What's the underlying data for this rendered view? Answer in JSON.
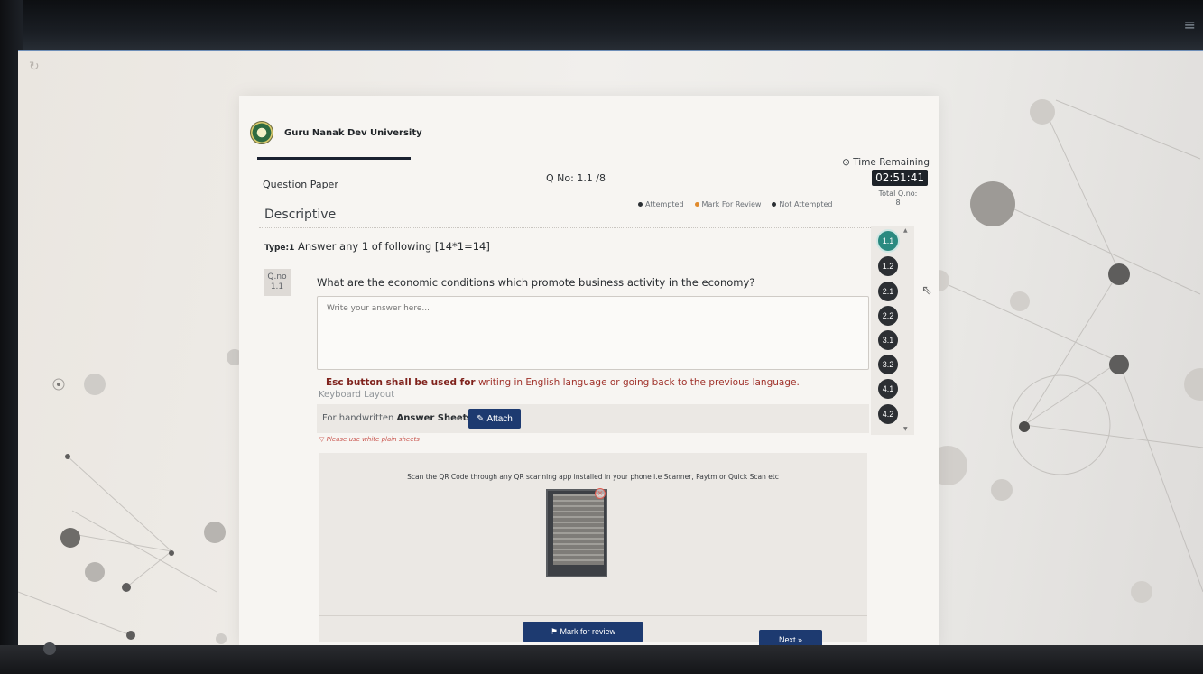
{
  "header": {
    "university": "Guru Nanak Dev University",
    "time_label": "⊙ Time Remaining",
    "time_value": "02:51:41"
  },
  "paper": {
    "question_paper_label": "Question Paper",
    "qno_text": "Q No:  1.1 /8",
    "section": "Descriptive",
    "total_label": "Total Q.no:",
    "total_value": "8"
  },
  "legend": {
    "attempted": "Attempted",
    "mark_for_review": "Mark For Review",
    "not_attempted": "Not Attempted",
    "colors": {
      "attempted": "#2b2f33",
      "mark_for_review": "#e08a2c",
      "not_attempted": "#2b2f33"
    }
  },
  "question": {
    "type_prefix": "Type:1",
    "type_text": "Answer any 1 of following [14*1=14]",
    "qno_badge_label": "Q.no",
    "qno_badge_value": "1.1",
    "text": "What are the economic conditions which promote business activity in the economy?",
    "answer_placeholder": "Write your answer here...",
    "esc_note_bold": "Esc button shall be used for",
    "esc_note_rest": " writing in English language or going back to the previous language.",
    "keyboard_layout_alt": "Keyboard Layout",
    "handwritten_label": "For handwritten ",
    "answer_sheets_label": "Answer Sheets",
    "attach_label": "Attach",
    "sheet_note": "Please use white plain sheets",
    "qr_instruction": "Scan the QR Code through any QR scanning app installed in your phone i.e Scanner, Paytm or Quick Scan etc"
  },
  "buttons": {
    "mark_for_review": "Mark for review",
    "next": "Next »"
  },
  "palette": {
    "items": [
      "1.1",
      "1.2",
      "2.1",
      "2.2",
      "3.1",
      "3.2",
      "4.1",
      "4.2"
    ],
    "active": "1.1",
    "active_color": "#2a8a80"
  }
}
